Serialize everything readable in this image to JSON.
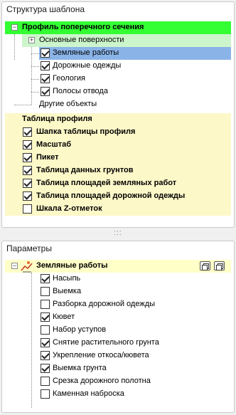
{
  "template_panel": {
    "title": "Структура шаблона",
    "cross_section": {
      "label": "Профиль поперечного сечения",
      "basic_surfaces": {
        "label": "Основные поверхности",
        "items": [
          {
            "label": "Земляные работы",
            "checked": true,
            "selected": true
          },
          {
            "label": "Дорожные одежды",
            "checked": true
          },
          {
            "label": "Геология",
            "checked": true
          },
          {
            "label": "Полосы отвода",
            "checked": true
          }
        ]
      },
      "other_objects_label": "Другие объекты"
    },
    "profile_table": {
      "label": "Таблица профиля",
      "items": [
        {
          "label": "Шапка таблицы профиля",
          "checked": true
        },
        {
          "label": "Масштаб",
          "checked": true
        },
        {
          "label": "Пикет",
          "checked": true
        },
        {
          "label": "Таблица данных грунтов",
          "checked": true
        },
        {
          "label": "Таблица площадей земляных работ",
          "checked": true
        },
        {
          "label": "Таблица площадей дорожной одежды",
          "checked": true
        },
        {
          "label": "Шкала Z-отметок",
          "checked": false
        }
      ]
    }
  },
  "params_panel": {
    "title": "Параметры",
    "group": {
      "label": "Земляные работы",
      "items": [
        {
          "label": "Насыпь",
          "checked": true
        },
        {
          "label": "Выемка",
          "checked": false
        },
        {
          "label": "Разборка дорожной одежды",
          "checked": false
        },
        {
          "label": "Кювет",
          "checked": true
        },
        {
          "label": "Набор уступов",
          "checked": false
        },
        {
          "label": "Снятие растительного грунта",
          "checked": true
        },
        {
          "label": "Укрепление откоса/кювета",
          "checked": true
        },
        {
          "label": "Выемка грунта",
          "checked": true
        },
        {
          "label": "Срезка дорожного полотна",
          "checked": false
        },
        {
          "label": "Каменная наброска",
          "checked": false
        }
      ]
    }
  },
  "colors": {
    "root_highlight": "#33ff33",
    "surfaces_highlight": "#ccf5cc",
    "selected_row": "#8ab4e8",
    "table_rows": "#fdf8c8",
    "group_header": "#ffffc8"
  },
  "icons": [
    "expander-minus-icon",
    "expander-plus-icon",
    "earthwork-icon",
    "copy-icon",
    "paste-icon",
    "splitter-grip-icon"
  ]
}
